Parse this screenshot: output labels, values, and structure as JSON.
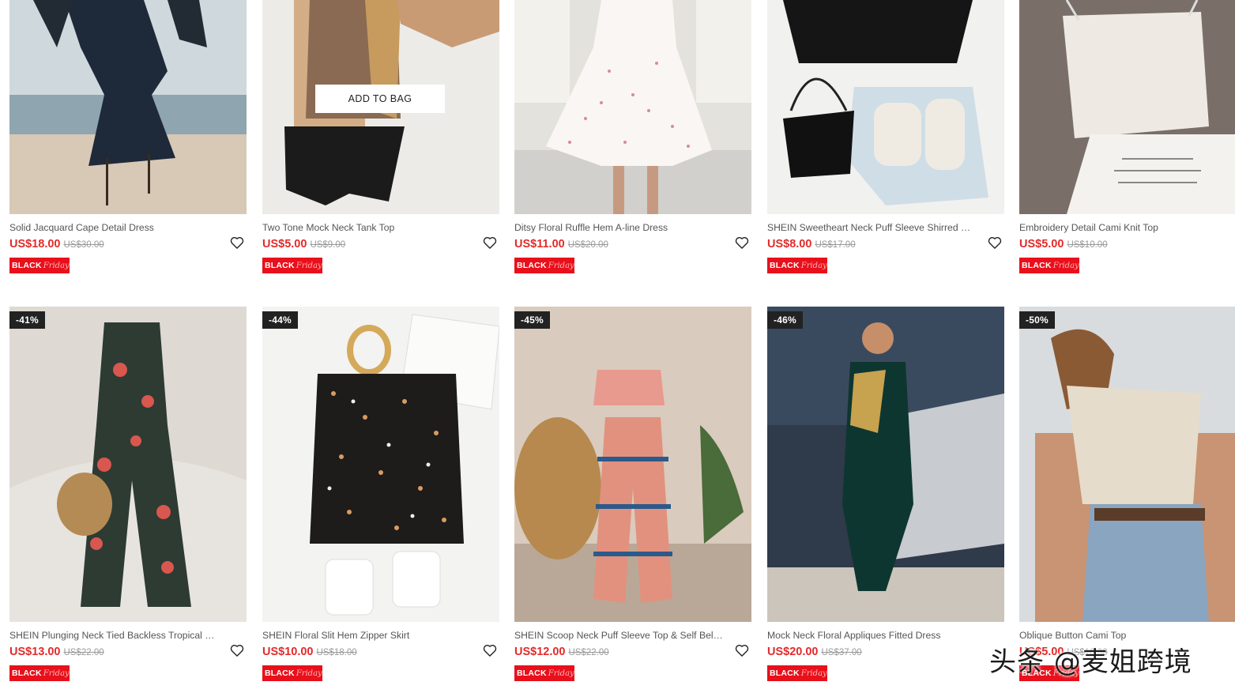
{
  "overlay": {
    "add_to_bag": "ADD TO BAG"
  },
  "badge": {
    "black": "BLACK",
    "friday": "Friday"
  },
  "watermark": "头条 @麦姐跨境",
  "colors": {
    "price": "#e32a2a",
    "badge_bg": "#e8101b",
    "discount_bg": "#222222"
  },
  "products": [
    {
      "title": "Solid Jacquard Cape Detail Dress",
      "price": "US$18.00",
      "original": "US$30.00",
      "discount": ""
    },
    {
      "title": "Two Tone Mock Neck Tank Top",
      "price": "US$5.00",
      "original": "US$9.00",
      "discount": ""
    },
    {
      "title": "Ditsy Floral Ruffle Hem A-line Dress",
      "price": "US$11.00",
      "original": "US$20.00",
      "discount": ""
    },
    {
      "title": "SHEIN Sweetheart Neck Puff Sleeve Shirred Detail L...",
      "price": "US$8.00",
      "original": "US$17.00",
      "discount": ""
    },
    {
      "title": "Embroidery Detail Cami Knit Top",
      "price": "US$5.00",
      "original": "US$10.00",
      "discount": ""
    },
    {
      "title": "SHEIN Plunging Neck Tied Backless Tropical Print Ha...",
      "price": "US$13.00",
      "original": "US$22.00",
      "discount": "-41%"
    },
    {
      "title": "SHEIN Floral Slit Hem Zipper Skirt",
      "price": "US$10.00",
      "original": "US$18.00",
      "discount": "-44%"
    },
    {
      "title": "SHEIN Scoop Neck Puff Sleeve Top & Self Belted Pa...",
      "price": "US$12.00",
      "original": "US$22.00",
      "discount": "-45%"
    },
    {
      "title": "Mock Neck Floral Appliques Fitted Dress",
      "price": "US$20.00",
      "original": "US$37.00",
      "discount": "-46%"
    },
    {
      "title": "Oblique Button Cami Top",
      "price": "US$5.00",
      "original": "US$10.00",
      "discount": "-50%"
    }
  ]
}
